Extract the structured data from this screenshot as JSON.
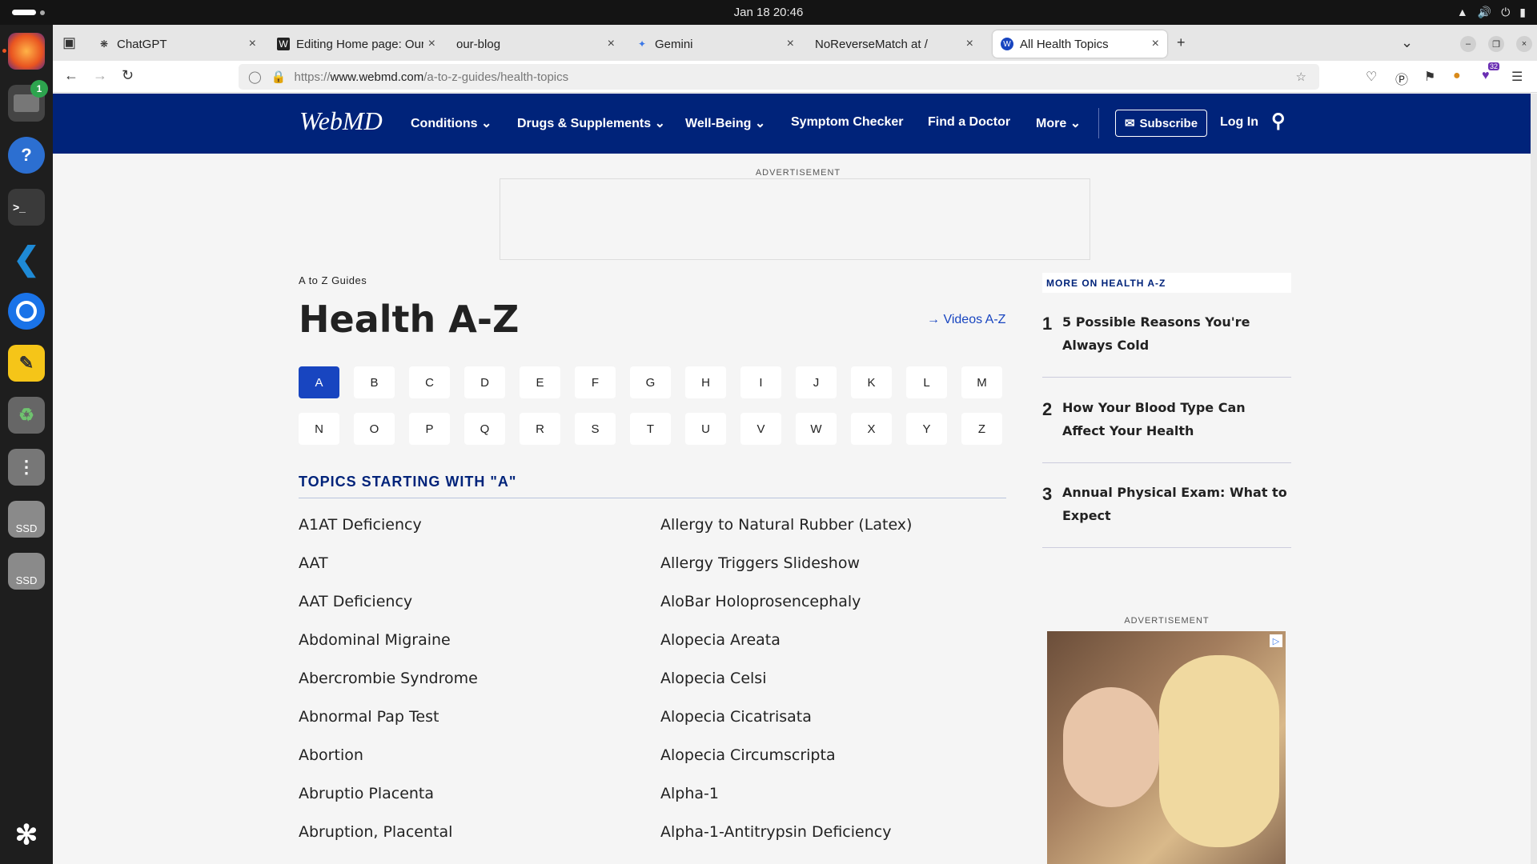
{
  "system": {
    "clock": "Jan 18  20:46"
  },
  "dock": {
    "badge_count": "1",
    "ssd_label_1": "SSD",
    "ssd_label_2": "SSD"
  },
  "tabs": [
    {
      "label": "ChatGPT",
      "icon": "chatgpt-icon"
    },
    {
      "label": "Editing Home page: Our E",
      "icon": "wordpress-icon"
    },
    {
      "label": "our-blog",
      "icon": ""
    },
    {
      "label": "Gemini",
      "icon": "gemini-icon"
    },
    {
      "label": "NoReverseMatch at /",
      "icon": ""
    },
    {
      "label": "All Health Topics",
      "icon": "webmd-icon"
    }
  ],
  "address": {
    "scheme": "https://",
    "host": "www.webmd.com",
    "path": "/a-to-z-guides/health-topics"
  },
  "toolbar": {
    "extension_badge": "32"
  },
  "header": {
    "logo": "WebMD",
    "nav": [
      "Conditions",
      "Drugs & Supplements",
      "Well-Being",
      "Symptom Checker",
      "Find a Doctor",
      "More"
    ],
    "subscribe": "Subscribe",
    "login": "Log In"
  },
  "main": {
    "ad_label": "ADVERTISEMENT",
    "breadcrumb": "A to Z Guides",
    "title": "Health A-Z",
    "videos_link": "Videos A-Z",
    "letters_row1": [
      "A",
      "B",
      "C",
      "D",
      "E",
      "F",
      "G",
      "H",
      "I",
      "J",
      "K",
      "L",
      "M"
    ],
    "letters_row2": [
      "N",
      "O",
      "P",
      "Q",
      "R",
      "S",
      "T",
      "U",
      "V",
      "W",
      "X",
      "Y",
      "Z"
    ],
    "active_letter": "A",
    "topics_heading": "TOPICS STARTING WITH \"A\"",
    "topics_left": [
      "A1AT Deficiency",
      "AAT",
      "AAT Deficiency",
      "Abdominal Migraine",
      "Abercrombie Syndrome",
      "Abnormal Pap Test",
      "Abortion",
      "Abruptio Placenta",
      "Abruption, Placental"
    ],
    "topics_right": [
      "Allergy to Natural Rubber (Latex)",
      "Allergy Triggers Slideshow",
      "AloBar Holoprosencephaly",
      "Alopecia Areata",
      "Alopecia Celsi",
      "Alopecia Cicatrisata",
      "Alopecia Circumscripta",
      "Alpha-1",
      "Alpha-1-Antitrypsin Deficiency"
    ]
  },
  "sidebar": {
    "heading": "MORE ON HEALTH A-Z",
    "items": [
      {
        "num": "1",
        "text": "5 Possible Reasons You're Always Cold"
      },
      {
        "num": "2",
        "text": "How Your Blood Type Can Affect Your Health"
      },
      {
        "num": "3",
        "text": "Annual Physical Exam: What to Expect"
      }
    ],
    "ad_label": "ADVERTISEMENT"
  },
  "colors": {
    "brand_navy": "#00237a",
    "link_blue": "#1845c0"
  }
}
